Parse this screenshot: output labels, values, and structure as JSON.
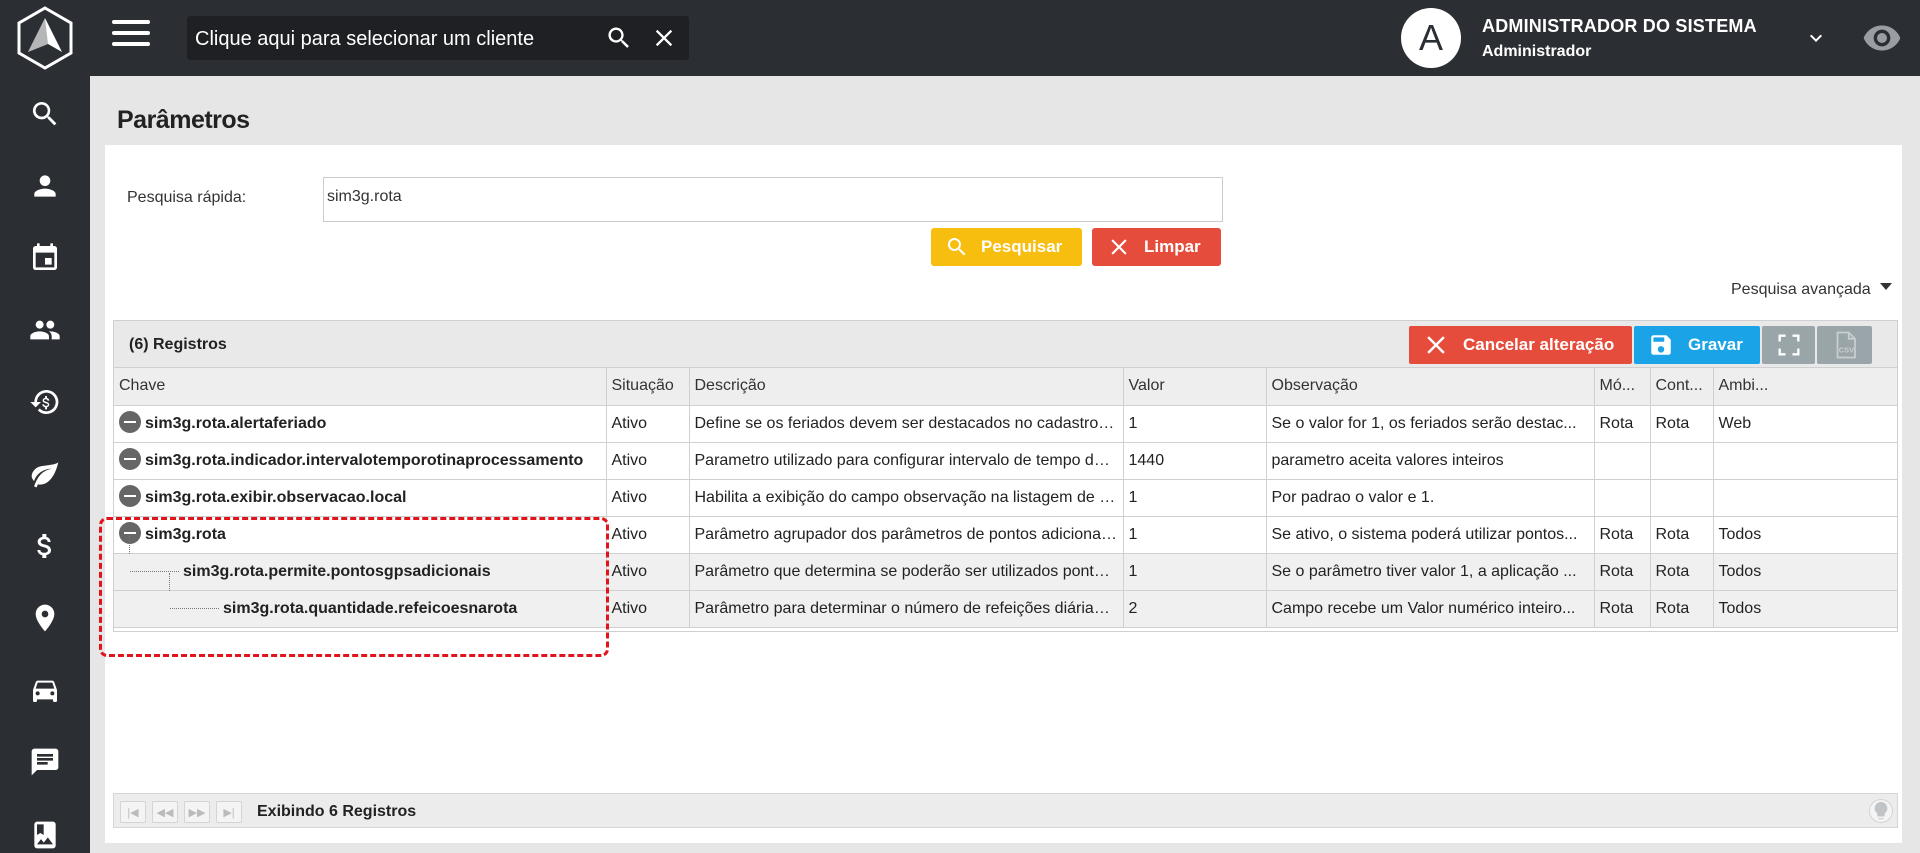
{
  "topbar": {
    "client_search_placeholder": "Clique aqui para selecionar um cliente",
    "user_initial": "A",
    "user_name": "ADMINISTRADOR DO SISTEMA",
    "user_role": "Administrador"
  },
  "sidebar": {
    "items": [
      "search-icon",
      "person-icon",
      "calendar-icon",
      "people-icon",
      "money-history-icon",
      "leaf-icon",
      "dollar-icon",
      "location-pin-icon",
      "car-icon",
      "message-icon",
      "photo-album-icon"
    ]
  },
  "page": {
    "title": "Parâmetros",
    "quick_search_label": "Pesquisa rápida:",
    "quick_search_value": "sim3g.rota",
    "search_button": "Pesquisar",
    "clear_button": "Limpar",
    "advanced_search": "Pesquisa avançada"
  },
  "grid": {
    "record_count": "(6) Registros",
    "cancel_button": "Cancelar alteração",
    "save_button": "Gravar",
    "columns": [
      "Chave",
      "Situação",
      "Descrição",
      "Valor",
      "Observação",
      "Mó...",
      "Cont...",
      "Ambi..."
    ],
    "rows": [
      {
        "key": "sim3g.rota.alertaferiado",
        "status": "Ativo",
        "description": "Define se os feriados devem ser destacados no cadastro de rota do ti...",
        "value": "1",
        "observation": "Se o valor for 1, os feriados serão destac...",
        "module": "Rota",
        "context": "Rota",
        "environment": "Web"
      },
      {
        "key": "sim3g.rota.indicador.intervalotemporotinaprocessamento",
        "status": "Ativo",
        "description": "Parametro utilizado para configurar intervalo de tempo da rotina de p...",
        "value": "1440",
        "observation": "parametro aceita valores inteiros",
        "module": "",
        "context": "",
        "environment": ""
      },
      {
        "key": "sim3g.rota.exibir.observacao.local",
        "status": "Ativo",
        "description": "Habilita a exibição do campo observação na listagem de rotas de um...",
        "value": "1",
        "observation": "Por padrao o valor e 1.",
        "module": "",
        "context": "",
        "environment": ""
      },
      {
        "key": "sim3g.rota",
        "status": "Ativo",
        "description": "Parâmetro agrupador dos parâmetros de pontos adicionais e qtde de...",
        "value": "1",
        "observation": "Se ativo, o sistema poderá utilizar pontos...",
        "module": "Rota",
        "context": "Rota",
        "environment": "Todos"
      },
      {
        "key": "sim3g.rota.permite.pontosgpsadicionais",
        "status": "Ativo",
        "description": "Parâmetro que determina se poderão ser utilizados pontos adicionais...",
        "value": "1",
        "observation": "Se o parâmetro tiver valor 1, a aplicação ...",
        "module": "Rota",
        "context": "Rota",
        "environment": "Todos"
      },
      {
        "key": "sim3g.rota.quantidade.refeicoesnarota",
        "status": "Ativo",
        "description": "Parâmetro para determinar o número de refeições diárias permitidas.",
        "value": "2",
        "observation": "Campo recebe um Valor numérico inteiro...",
        "module": "Rota",
        "context": "Rota",
        "environment": "Todos"
      }
    ],
    "footer_text": "Exibindo 6 Registros"
  },
  "colors": {
    "sidebar_bg": "#2b2e33",
    "search_button": "#f7bd0f",
    "clear_button": "#e64c3c",
    "cancel_button": "#e64c3c",
    "save_button": "#1aa3e6",
    "highlight": "#e1141b"
  }
}
